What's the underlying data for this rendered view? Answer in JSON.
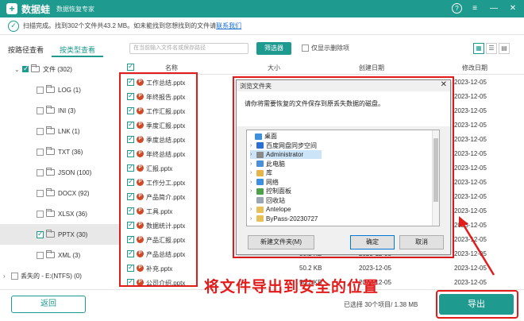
{
  "app": {
    "name": "数据蛙",
    "subtitle": "数据恢复专家"
  },
  "status": {
    "message": "扫描完成。找到302个文件共43.2 MB。如未能找到您想找到的文件请",
    "link": "联系我们"
  },
  "tabs": [
    {
      "label": "按路径查看"
    },
    {
      "label": "按类型查看"
    }
  ],
  "search": {
    "placeholder": "在当前输入文件名或保存路径"
  },
  "filter_label": "筛选器",
  "only_deleted_label": "仅显示删除项",
  "tree": [
    {
      "label": "文件 (302)",
      "level": 0,
      "checked": "partial",
      "expanded": true
    },
    {
      "label": "LOG (1)",
      "level": 1,
      "checked": false
    },
    {
      "label": "INI (3)",
      "level": 1,
      "checked": false
    },
    {
      "label": "LNK (1)",
      "level": 1,
      "checked": false
    },
    {
      "label": "TXT (36)",
      "level": 1,
      "checked": false
    },
    {
      "label": "JSON (100)",
      "level": 1,
      "checked": false
    },
    {
      "label": "DOCX (92)",
      "level": 1,
      "checked": false
    },
    {
      "label": "XLSX (36)",
      "level": 1,
      "checked": false
    },
    {
      "label": "PPTX (30)",
      "level": 1,
      "checked": true,
      "selected": true
    },
    {
      "label": "XML (3)",
      "level": 1,
      "checked": false
    },
    {
      "label": "丢失的 - E:(NTFS) (0)",
      "level": 0,
      "checked": false,
      "collapsed": true
    }
  ],
  "columns": {
    "name": "名称",
    "size": "大小",
    "created": "创建日期",
    "modified": "修改日期"
  },
  "files": [
    {
      "name": "工作总结.pptx",
      "size": "",
      "created": "",
      "modified": "2023-12-05"
    },
    {
      "name": "年终报告.pptx",
      "size": "",
      "created": "",
      "modified": "2023-12-05"
    },
    {
      "name": "工作汇报.pptx",
      "size": "",
      "created": "",
      "modified": "2023-12-05"
    },
    {
      "name": "季度汇报.pptx",
      "size": "",
      "created": "",
      "modified": "2023-12-05"
    },
    {
      "name": "季度总结.pptx",
      "size": "",
      "created": "",
      "modified": "2023-12-05"
    },
    {
      "name": "年终总结.pptx",
      "size": "",
      "created": "",
      "modified": "2023-12-05"
    },
    {
      "name": "汇报.pptx",
      "size": "",
      "created": "",
      "modified": "2023-12-05"
    },
    {
      "name": "工作分工.pptx",
      "size": "",
      "created": "",
      "modified": "2023-12-05"
    },
    {
      "name": "产品简介.pptx",
      "size": "",
      "created": "",
      "modified": "2023-12-05"
    },
    {
      "name": "工具.pptx",
      "size": "",
      "created": "",
      "modified": "2023-12-05"
    },
    {
      "name": "数据统计.pptx",
      "size": "",
      "created": "",
      "modified": "2023-12-05"
    },
    {
      "name": "产品汇报.pptx",
      "size": "",
      "created": "",
      "modified": "2023-12-05"
    },
    {
      "name": "产品总结.pptx",
      "size": "50.2 KB",
      "created": "2023-12-05",
      "modified": "2023-12-05"
    },
    {
      "name": "补充.pptx",
      "size": "50.2 KB",
      "created": "2023-12-05",
      "modified": "2023-12-05"
    },
    {
      "name": "公司介绍.pptx",
      "size": "50.2 KB",
      "created": "2023-12-05",
      "modified": "2023-12-05"
    }
  ],
  "dialog": {
    "title": "浏览文件夹",
    "message": "请你将需要恢复的文件保存到原丢失数据的磁盘。",
    "tree": [
      {
        "label": "桌面",
        "indent": 0,
        "chevron": "",
        "icon": "#3d8fe0"
      },
      {
        "label": "百度网盘同步空间",
        "indent": 1,
        "chevron": "›",
        "icon": "#2a6fd1"
      },
      {
        "label": "Administrator",
        "indent": 1,
        "chevron": "›",
        "icon": "#8a8a8a",
        "selected": true
      },
      {
        "label": "此电脑",
        "indent": 1,
        "chevron": "›",
        "icon": "#4a90d9"
      },
      {
        "label": "库",
        "indent": 1,
        "chevron": "›",
        "icon": "#e6b54a"
      },
      {
        "label": "网络",
        "indent": 1,
        "chevron": "›",
        "icon": "#3d8fe0"
      },
      {
        "label": "控制面板",
        "indent": 1,
        "chevron": "›",
        "icon": "#4fa04a"
      },
      {
        "label": "回收站",
        "indent": 1,
        "chevron": "",
        "icon": "#9aa6b2"
      },
      {
        "label": "Antelope",
        "indent": 1,
        "chevron": "›",
        "icon": "#e6c15a"
      },
      {
        "label": "ByPass-20230727",
        "indent": 1,
        "chevron": "›",
        "icon": "#e6c15a"
      }
    ],
    "new_folder": "新建文件夹(M)",
    "ok": "确定",
    "cancel": "取消"
  },
  "annotation": "将文件导出到安全的位置",
  "bottom": {
    "back": "返回",
    "selection_info": "已选择 30个项目/ 1.38 MB",
    "export": "导出"
  },
  "colors": {
    "accent": "#1e9a8f",
    "highlight": "#e21b1b"
  }
}
